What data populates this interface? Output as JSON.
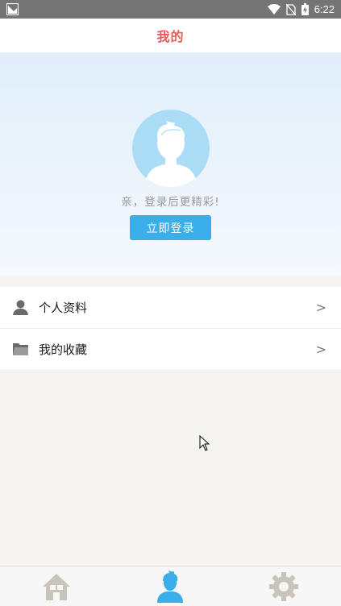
{
  "status_bar": {
    "time": "6:22",
    "icons": [
      "notification-icon",
      "wifi-icon",
      "no-sim-icon",
      "battery-icon"
    ]
  },
  "header": {
    "title": "我的"
  },
  "hero": {
    "tip": "亲，登录后更精彩!",
    "login_button": "立即登录"
  },
  "menu": {
    "items": [
      {
        "label": "个人资料",
        "icon": "person-icon",
        "arrow": ">"
      },
      {
        "label": "我的收藏",
        "icon": "folder-icon",
        "arrow": ">"
      }
    ]
  },
  "tabs": [
    {
      "icon": "home-icon",
      "active": false
    },
    {
      "icon": "user-icon",
      "active": true
    },
    {
      "icon": "gear-icon",
      "active": false
    }
  ],
  "colors": {
    "title": "#e85a5a",
    "accent": "#3aaee8",
    "avatar_bg": "#abdcf6",
    "tab_inactive": "#c9c4bb"
  }
}
